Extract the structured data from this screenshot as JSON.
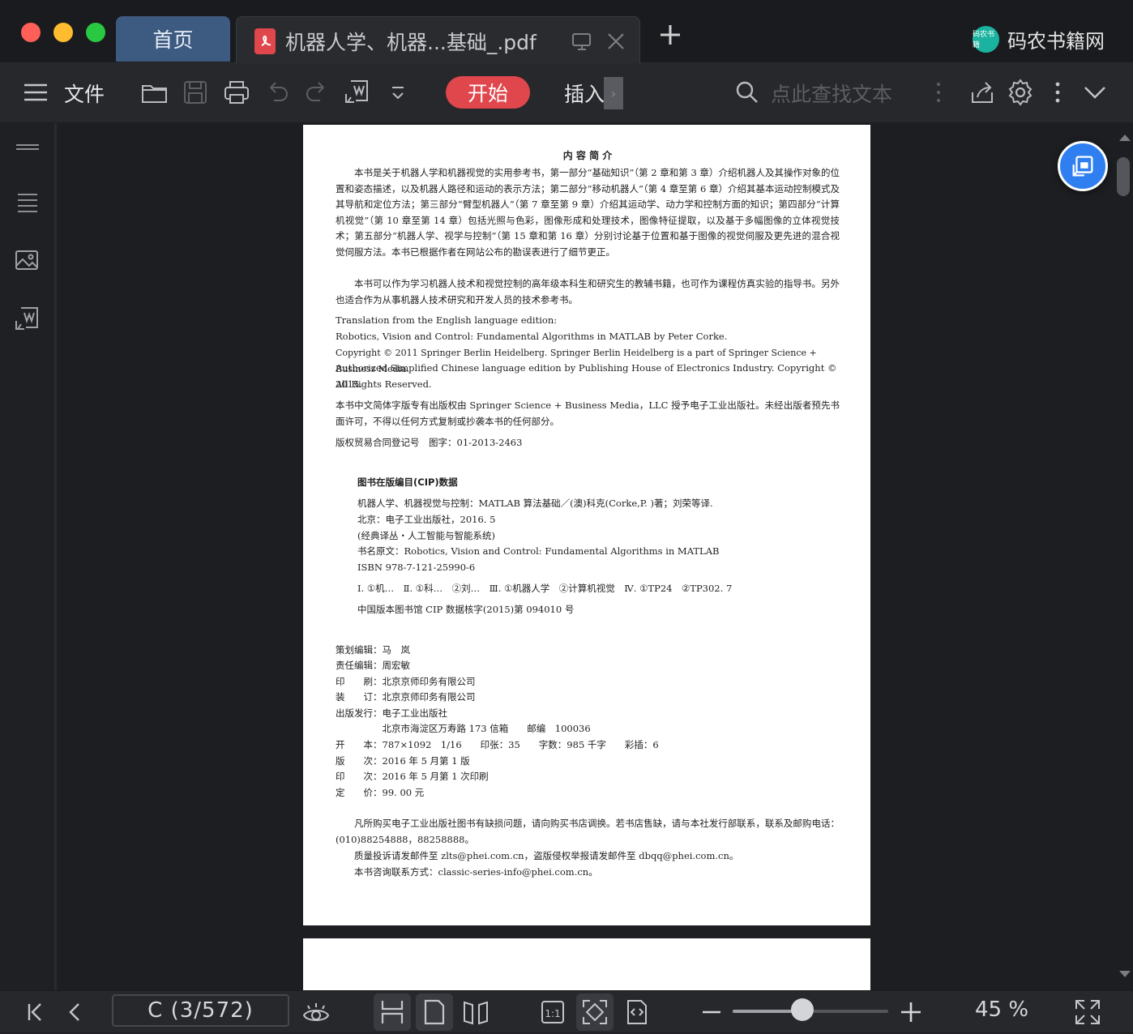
{
  "window": {
    "tabs": [
      {
        "label": "首页"
      },
      {
        "label": "机器人学、机器...基础_.pdf"
      }
    ],
    "brand": {
      "logo_text": "码农书籍",
      "name": "码农书籍网"
    }
  },
  "toolbar": {
    "file_label": "文件",
    "start_label": "开始",
    "insert_label": "插入",
    "search_placeholder": "点此查找文本"
  },
  "document": {
    "intro_title": "内 容 简 介",
    "intro_p1": "本书是关于机器人学和机器视觉的实用参考书，第一部分“基础知识”（第 2 章和第 3 章）介绍机器人及其操作对象的位置和姿态描述，以及机器人路径和运动的表示方法；第二部分“移动机器人”（第 4 章至第 6 章）介绍其基本运动控制模式及其导航和定位方法；第三部分“臂型机器人”（第 7 章至第 9 章）介绍其运动学、动力学和控制方面的知识；第四部分“计算机视觉”（第 10 章至第 14 章）包括光照与色彩，图像形成和处理技术，图像特征提取，以及基于多幅图像的立体视觉技术；第五部分“机器人学、视学与控制”（第 15 章和第 16 章）分别讨论基于位置和基于图像的视觉伺服及更先进的混合视觉伺服方法。本书已根据作者在网站公布的勘误表进行了细节更正。",
    "intro_p2": "本书可以作为学习机器人技术和视觉控制的高年级本科生和研究生的教辅书籍，也可作为课程仿真实验的指导书。另外也适合作为从事机器人技术研究和开发人员的技术参考书。",
    "eng_lines": [
      "Translation from the English language edition:",
      "Robotics, Vision and Control: Fundamental Algorithms in MATLAB by Peter Corke.",
      "Copyright © 2011 Springer Berlin Heidelberg. Springer Berlin Heidelberg is a part of Springer Science + Business Media.",
      "Authorized Simplified Chinese language edition by Publishing House of Electronics Industry. Copyright © 2015.",
      "All Rights Reserved."
    ],
    "rights_cn": "本书中文简体字版专有出版权由 Springer Science + Business Media，LLC 授予电子工业出版社。未经出版者预先书面许可，不得以任何方式复制或抄袭本书的任何部分。",
    "contract_no": "版权贸易合同登记号　图字：01-2013-2463",
    "cip_title": "图书在版编目(CIP)数据",
    "cip_lines": [
      "机器人学、机器视觉与控制：MATLAB 算法基础／(澳)科克(Corke,P. )著；刘荣等译.",
      "北京：电子工业出版社，2016. 5",
      "(经典译丛・人工智能与智能系统)",
      "书名原文：Robotics, Vision and Control: Fundamental Algorithms in MATLAB",
      "ISBN 978-7-121-25990-6"
    ],
    "cip_class": "Ⅰ. ①机…　Ⅱ. ①科…　②刘…　Ⅲ. ①机器人学　②计算机视觉　Ⅳ. ①TP24　②TP302. 7",
    "cip_no": "中国版本图书馆 CIP 数据核字(2015)第 094010 号",
    "credits": [
      "策划编辑：马　岚",
      "责任编辑：周宏敏",
      "印　　刷：北京京师印务有限公司",
      "装　　订：北京京师印务有限公司",
      "出版发行：电子工业出版社",
      "　　　　　北京市海淀区万寿路 173 信箱　　邮编　100036",
      "开　　本：787×1092　1/16　　印张：35　　字数：985 千字　　彩插：6",
      "版　　次：2016 年 5 月第 1 版",
      "印　　次：2016 年 5 月第 1 次印刷",
      "定　　价：99. 00 元"
    ],
    "notice_p1": "凡所购买电子工业出版社图书有缺损问题，请向购买书店调换。若书店售缺，请与本社发行部联系，联系及邮购电话：(010)88254888，88258888。",
    "notice_p2": "质量投诉请发邮件至 zlts@phei.com.cn，盗版侵权举报请发邮件至 dbqq@phei.com.cn。",
    "notice_p3": "本书咨询联系方式：classic-series-info@phei.com.cn。"
  },
  "statusbar": {
    "page_indicator": "C (3/572)",
    "zoom_level": 0.45,
    "zoom_label": "45 %"
  },
  "colors": {
    "accent_red": "#e0474c",
    "home_tab": "#3d5a80",
    "float_button": "#2f7ff0",
    "brand_logo": "#19b3a0"
  }
}
